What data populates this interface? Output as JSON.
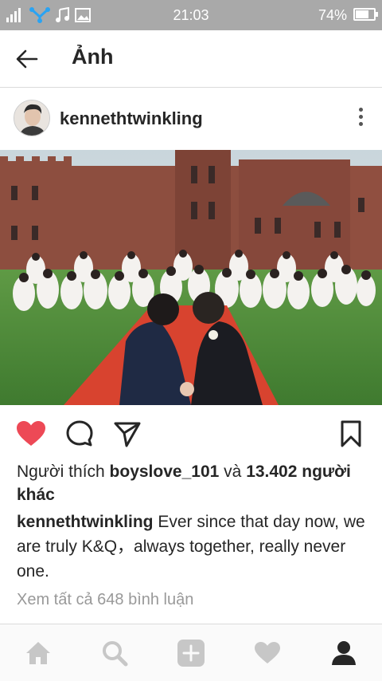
{
  "status_bar": {
    "time": "21:03",
    "battery_percent_text": "74%",
    "battery_level": 0.74,
    "left_icons": [
      "signal-icon",
      "app-icon",
      "music-icon",
      "image-icon"
    ]
  },
  "header": {
    "title": "Ảnh",
    "back_icon": "back-arrow-icon"
  },
  "post": {
    "username": "kennethtwinkling",
    "photo_icon": "wedding-photo"
  },
  "actions": [
    "heart-icon",
    "comment-icon",
    "share-icon",
    "bookmark-icon"
  ],
  "likes": {
    "prefix": "Người thích",
    "user": "boyslove_101",
    "connector": "và",
    "count": "13.402",
    "suffix": "người khác"
  },
  "caption": {
    "username": "kennethtwinkling",
    "text": "Ever since that day now, we are truly K&Q，always together, really never one."
  },
  "comments_link": "Xem tất cả 648 bình luận",
  "bottom_nav": [
    "home-icon",
    "search-icon",
    "add-icon",
    "activity-icon",
    "profile-icon"
  ],
  "colors": {
    "status_bar": "#a9a9a9",
    "like_red": "#ed4956",
    "carpet": "#d8432f",
    "grass": "#4e8a3a",
    "brick": "#8b4a3c"
  }
}
